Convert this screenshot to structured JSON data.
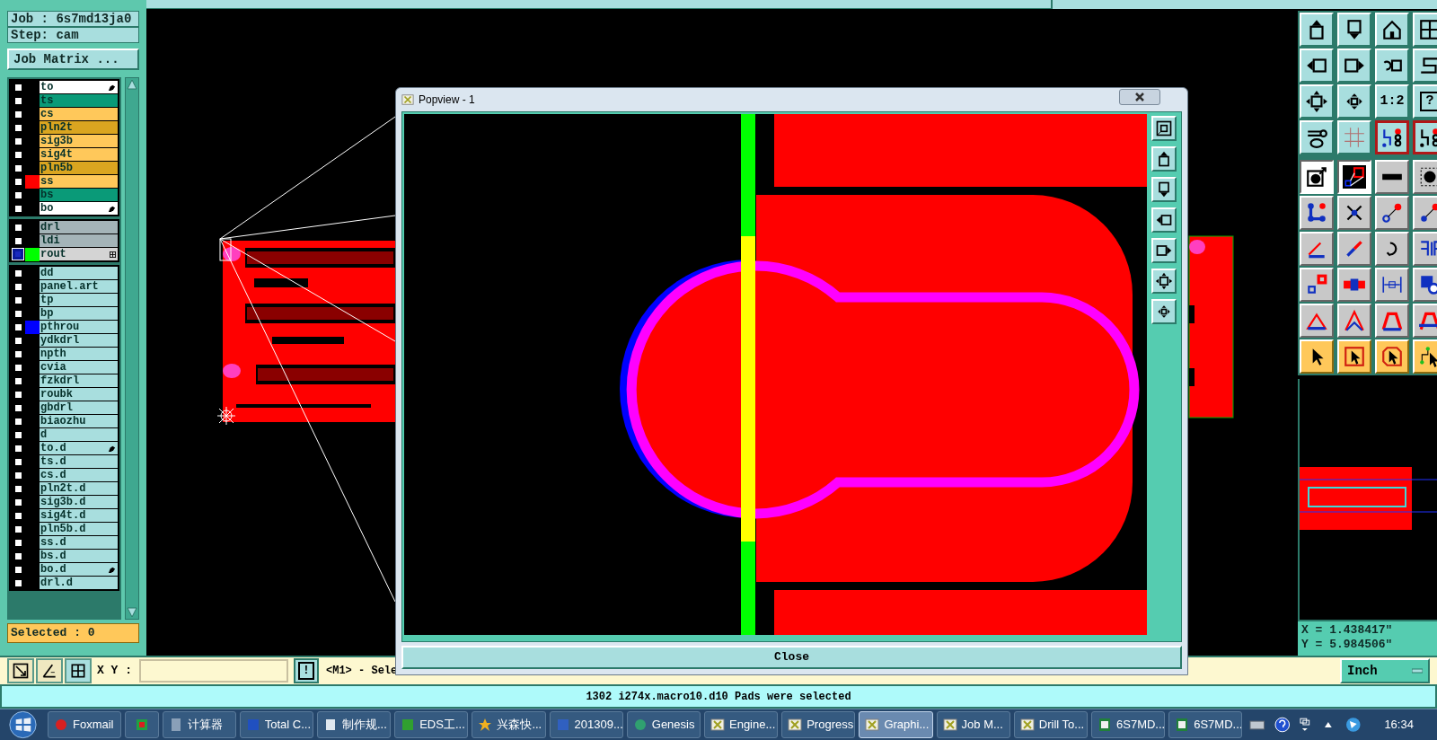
{
  "job": {
    "label": "Job : 6s7md13ja0",
    "step": "Step: cam",
    "matrix_button": "Job Matrix ..."
  },
  "layer_groups": [
    {
      "layers": [
        {
          "name": "to",
          "kind": "silk",
          "marked": true,
          "selected": false
        },
        {
          "name": "ts",
          "kind": "mask",
          "marked": false,
          "selected": false
        },
        {
          "name": "cs",
          "kind": "signal",
          "marked": false,
          "selected": false
        },
        {
          "name": "pln2t",
          "kind": "power",
          "marked": false,
          "selected": false
        },
        {
          "name": "sig3b",
          "kind": "signal",
          "marked": false,
          "selected": false
        },
        {
          "name": "sig4t",
          "kind": "signal",
          "marked": false,
          "selected": false
        },
        {
          "name": "pln5b",
          "kind": "power",
          "marked": false,
          "selected": false
        },
        {
          "name": "ss",
          "kind": "signal",
          "marked": false,
          "selected": false,
          "color": "#ff0000"
        },
        {
          "name": "bs",
          "kind": "mask",
          "marked": false,
          "selected": false
        },
        {
          "name": "bo",
          "kind": "silk",
          "marked": true,
          "selected": false
        }
      ]
    },
    {
      "layers": [
        {
          "name": "drl",
          "kind": "drill",
          "marked": false,
          "selected": false
        },
        {
          "name": "ldi",
          "kind": "drill",
          "marked": false,
          "selected": false
        },
        {
          "name": "rout",
          "kind": "rout",
          "marked": false,
          "selected": true,
          "color": "#00ff00"
        }
      ]
    },
    {
      "layers": [
        {
          "name": "dd",
          "kind": "misc",
          "marked": false,
          "selected": false
        },
        {
          "name": "panel.art",
          "kind": "misc",
          "marked": false,
          "selected": false
        },
        {
          "name": "tp",
          "kind": "misc",
          "marked": false,
          "selected": false
        },
        {
          "name": "bp",
          "kind": "misc",
          "marked": false,
          "selected": false
        },
        {
          "name": "pthrou",
          "kind": "misc",
          "marked": false,
          "selected": false,
          "color": "#0000ff"
        },
        {
          "name": "ydkdrl",
          "kind": "misc",
          "marked": false,
          "selected": false
        },
        {
          "name": "npth",
          "kind": "misc",
          "marked": false,
          "selected": false
        },
        {
          "name": "cvia",
          "kind": "misc",
          "marked": false,
          "selected": false
        },
        {
          "name": "fzkdrl",
          "kind": "misc",
          "marked": false,
          "selected": false
        },
        {
          "name": "roubk",
          "kind": "misc",
          "marked": false,
          "selected": false
        },
        {
          "name": "gbdrl",
          "kind": "misc",
          "marked": false,
          "selected": false
        },
        {
          "name": "biaozhu",
          "kind": "misc",
          "marked": false,
          "selected": false
        },
        {
          "name": "d",
          "kind": "misc",
          "marked": false,
          "selected": false
        },
        {
          "name": "to.d",
          "kind": "misc",
          "marked": true,
          "selected": false
        },
        {
          "name": "ts.d",
          "kind": "misc",
          "marked": false,
          "selected": false
        },
        {
          "name": "cs.d",
          "kind": "misc",
          "marked": false,
          "selected": false
        },
        {
          "name": "pln2t.d",
          "kind": "misc",
          "marked": false,
          "selected": false
        },
        {
          "name": "sig3b.d",
          "kind": "misc",
          "marked": false,
          "selected": false
        },
        {
          "name": "sig4t.d",
          "kind": "misc",
          "marked": false,
          "selected": false
        },
        {
          "name": "pln5b.d",
          "kind": "misc",
          "marked": false,
          "selected": false
        },
        {
          "name": "ss.d",
          "kind": "misc",
          "marked": false,
          "selected": false
        },
        {
          "name": "bs.d",
          "kind": "misc",
          "marked": false,
          "selected": false
        },
        {
          "name": "bo.d",
          "kind": "misc",
          "marked": true,
          "selected": false
        },
        {
          "name": "drl.d",
          "kind": "misc",
          "marked": false,
          "selected": false
        }
      ]
    }
  ],
  "selected_count": "Selected : 0",
  "tools": [
    {
      "kind": "view",
      "selected": false
    },
    {
      "kind": "view",
      "selected": false
    },
    {
      "kind": "view",
      "selected": false
    },
    {
      "kind": "view",
      "selected": false
    },
    {
      "kind": "view",
      "selected": false
    },
    {
      "kind": "view",
      "selected": false
    },
    {
      "kind": "view",
      "selected": false
    },
    {
      "kind": "view",
      "selected": false
    },
    {
      "kind": "view",
      "selected": false
    },
    {
      "kind": "view",
      "selected": false
    },
    {
      "kind": "view",
      "selected": false,
      "label": "1:2"
    },
    {
      "kind": "view",
      "selected": false,
      "label": "?"
    },
    {
      "kind": "view",
      "selected": false
    },
    {
      "kind": "view",
      "selected": false
    },
    {
      "kind": "view",
      "selected": true
    },
    {
      "kind": "view",
      "selected": true
    },
    {
      "kind": "edit",
      "selected": true
    },
    {
      "kind": "edit",
      "selected": true
    },
    {
      "kind": "edit",
      "selected": false
    },
    {
      "kind": "edit",
      "selected": false
    },
    {
      "kind": "edit",
      "selected": false
    },
    {
      "kind": "edit",
      "selected": false
    },
    {
      "kind": "edit",
      "selected": false
    },
    {
      "kind": "edit",
      "selected": false
    },
    {
      "kind": "edit",
      "selected": false
    },
    {
      "kind": "edit",
      "selected": false
    },
    {
      "kind": "edit",
      "selected": false
    },
    {
      "kind": "edit",
      "selected": false
    },
    {
      "kind": "edit",
      "selected": false
    },
    {
      "kind": "edit",
      "selected": false
    },
    {
      "kind": "edit",
      "selected": false
    },
    {
      "kind": "edit",
      "selected": false
    },
    {
      "kind": "edit",
      "selected": false
    },
    {
      "kind": "edit",
      "selected": false
    },
    {
      "kind": "edit",
      "selected": false
    },
    {
      "kind": "edit",
      "selected": false
    },
    {
      "kind": "select",
      "selected": false
    },
    {
      "kind": "select",
      "selected": false
    },
    {
      "kind": "select",
      "selected": false
    },
    {
      "kind": "select",
      "selected": false
    }
  ],
  "coordinates": [
    "X = 1.438417\"",
    "Y = 5.984506\""
  ],
  "popview": {
    "title": "Popview - 1",
    "close_button": "Close"
  },
  "command_bar": {
    "xy_label": "X Y :",
    "action_button": "!",
    "message": "<M1> - Sele",
    "units": "Inch"
  },
  "status_bar": "1302 i274x.macro10.d10 Pads were selected",
  "taskbar": {
    "items": [
      {
        "label": "Foxmail",
        "selected": false
      },
      {
        "selected": false
      },
      {
        "label": "计算器",
        "selected": false
      },
      {
        "label": "Total C...",
        "selected": false
      },
      {
        "label": "制作规...",
        "selected": false
      },
      {
        "label": "EDS工...",
        "selected": false
      },
      {
        "label": "兴森快...",
        "selected": false
      },
      {
        "label": "201309...",
        "selected": false
      },
      {
        "label": "Genesis",
        "selected": false
      },
      {
        "label": "Engine...",
        "selected": false
      },
      {
        "label": "Progress",
        "selected": false
      },
      {
        "label": "Graphi...",
        "selected": true
      },
      {
        "label": "Job M...",
        "selected": false
      },
      {
        "label": "Drill To...",
        "selected": false
      },
      {
        "label": "6S7MD...",
        "selected": false
      },
      {
        "label": "6S7MD...",
        "selected": false
      }
    ],
    "clock": "16:34"
  }
}
